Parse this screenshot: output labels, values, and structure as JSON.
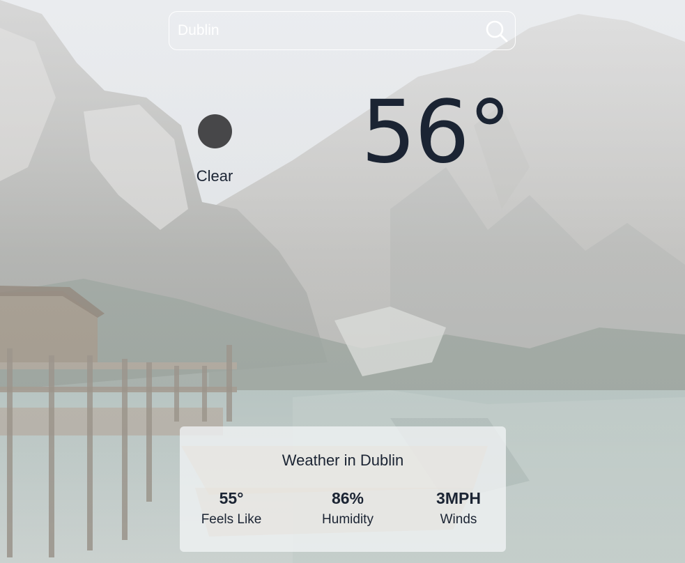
{
  "search": {
    "value": "Dublin",
    "icon": "search-icon"
  },
  "current": {
    "icon": "weather-icon",
    "condition": "Clear",
    "temperature": "56°"
  },
  "details": {
    "title": "Weather in Dublin",
    "feels_like": {
      "value": "55°",
      "label": "Feels Like"
    },
    "humidity": {
      "value": "86%",
      "label": "Humidity"
    },
    "winds": {
      "value": "3MPH",
      "label": "Winds"
    }
  },
  "colors": {
    "text": "#1b2433",
    "icon_dot": "#474749",
    "search_border": "#ffffff"
  }
}
